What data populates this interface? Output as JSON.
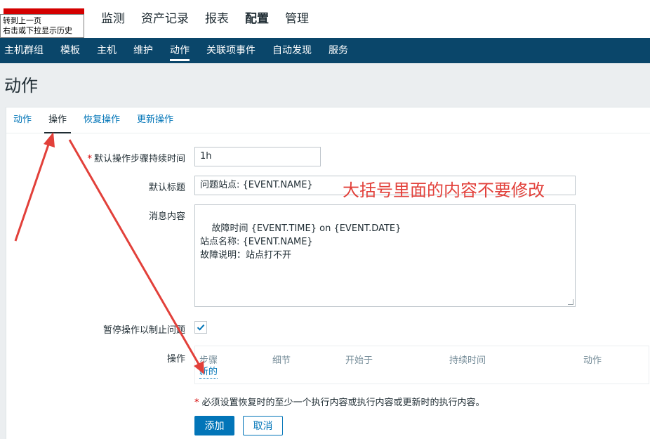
{
  "tooltip": {
    "line1": "转到上一页",
    "line2": "右击或下拉显示历史"
  },
  "main_nav": [
    {
      "label": "监测"
    },
    {
      "label": "资产记录"
    },
    {
      "label": "报表"
    },
    {
      "label": "配置"
    },
    {
      "label": "管理"
    }
  ],
  "sub_nav": [
    {
      "label": "主机群组"
    },
    {
      "label": "模板"
    },
    {
      "label": "主机"
    },
    {
      "label": "维护"
    },
    {
      "label": "动作"
    },
    {
      "label": "关联项事件"
    },
    {
      "label": "自动发现"
    },
    {
      "label": "服务"
    }
  ],
  "page": {
    "title": "动作"
  },
  "tabs": [
    {
      "label": "动作"
    },
    {
      "label": "操作"
    },
    {
      "label": "恢复操作"
    },
    {
      "label": "更新操作"
    }
  ],
  "form": {
    "step_duration_label": "默认操作步骤持续时间",
    "step_duration_value": "1h",
    "subject_label": "默认标题",
    "subject_value": "问题站点: {EVENT.NAME}",
    "message_label": "消息内容",
    "message_value": "故障时间 {EVENT.TIME} on {EVENT.DATE}\n站点名称: {EVENT.NAME}\n故障说明：站点打不开",
    "pause_label": "暂停操作以制止问题",
    "pause_checked": true,
    "operations_label": "操作",
    "required_mark": "*"
  },
  "operations_table": {
    "headers": [
      "步骤",
      "细节",
      "开始于",
      "持续时间",
      "动作"
    ],
    "new_link": "新的"
  },
  "note": {
    "mark": "*",
    "text": "必须设置恢复时的至少一个执行内容或执行内容或更新时的执行内容。"
  },
  "buttons": {
    "add": "添加",
    "cancel": "取消"
  },
  "annotation": {
    "text": "大括号里面的内容不要修改"
  },
  "colors": {
    "accent": "#0275b8",
    "subnav_bg": "#0a466a",
    "annotation": "#e2403a"
  }
}
